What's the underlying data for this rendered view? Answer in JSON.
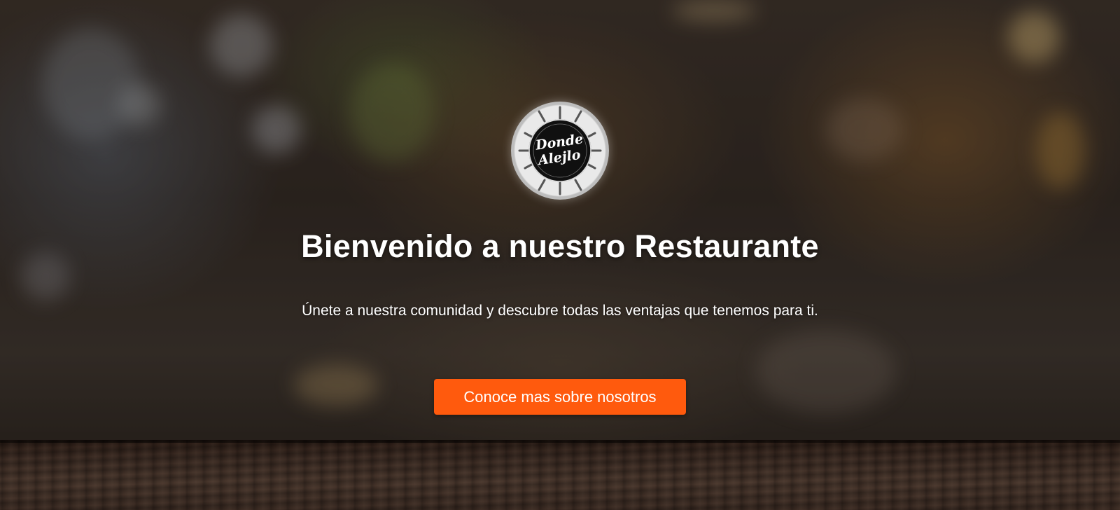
{
  "hero": {
    "logo_text": "Donde Alejlo",
    "title": "Bienvenido a nuestro Restaurante",
    "subtitle": "Únete a nuestra comunidad y descubre todas las ventajas que tenemos para ti.",
    "cta_label": "Conoce mas sobre nosotros"
  },
  "colors": {
    "accent": "#ff5a0d",
    "text": "#ffffff",
    "wood": "#3a2a22"
  }
}
